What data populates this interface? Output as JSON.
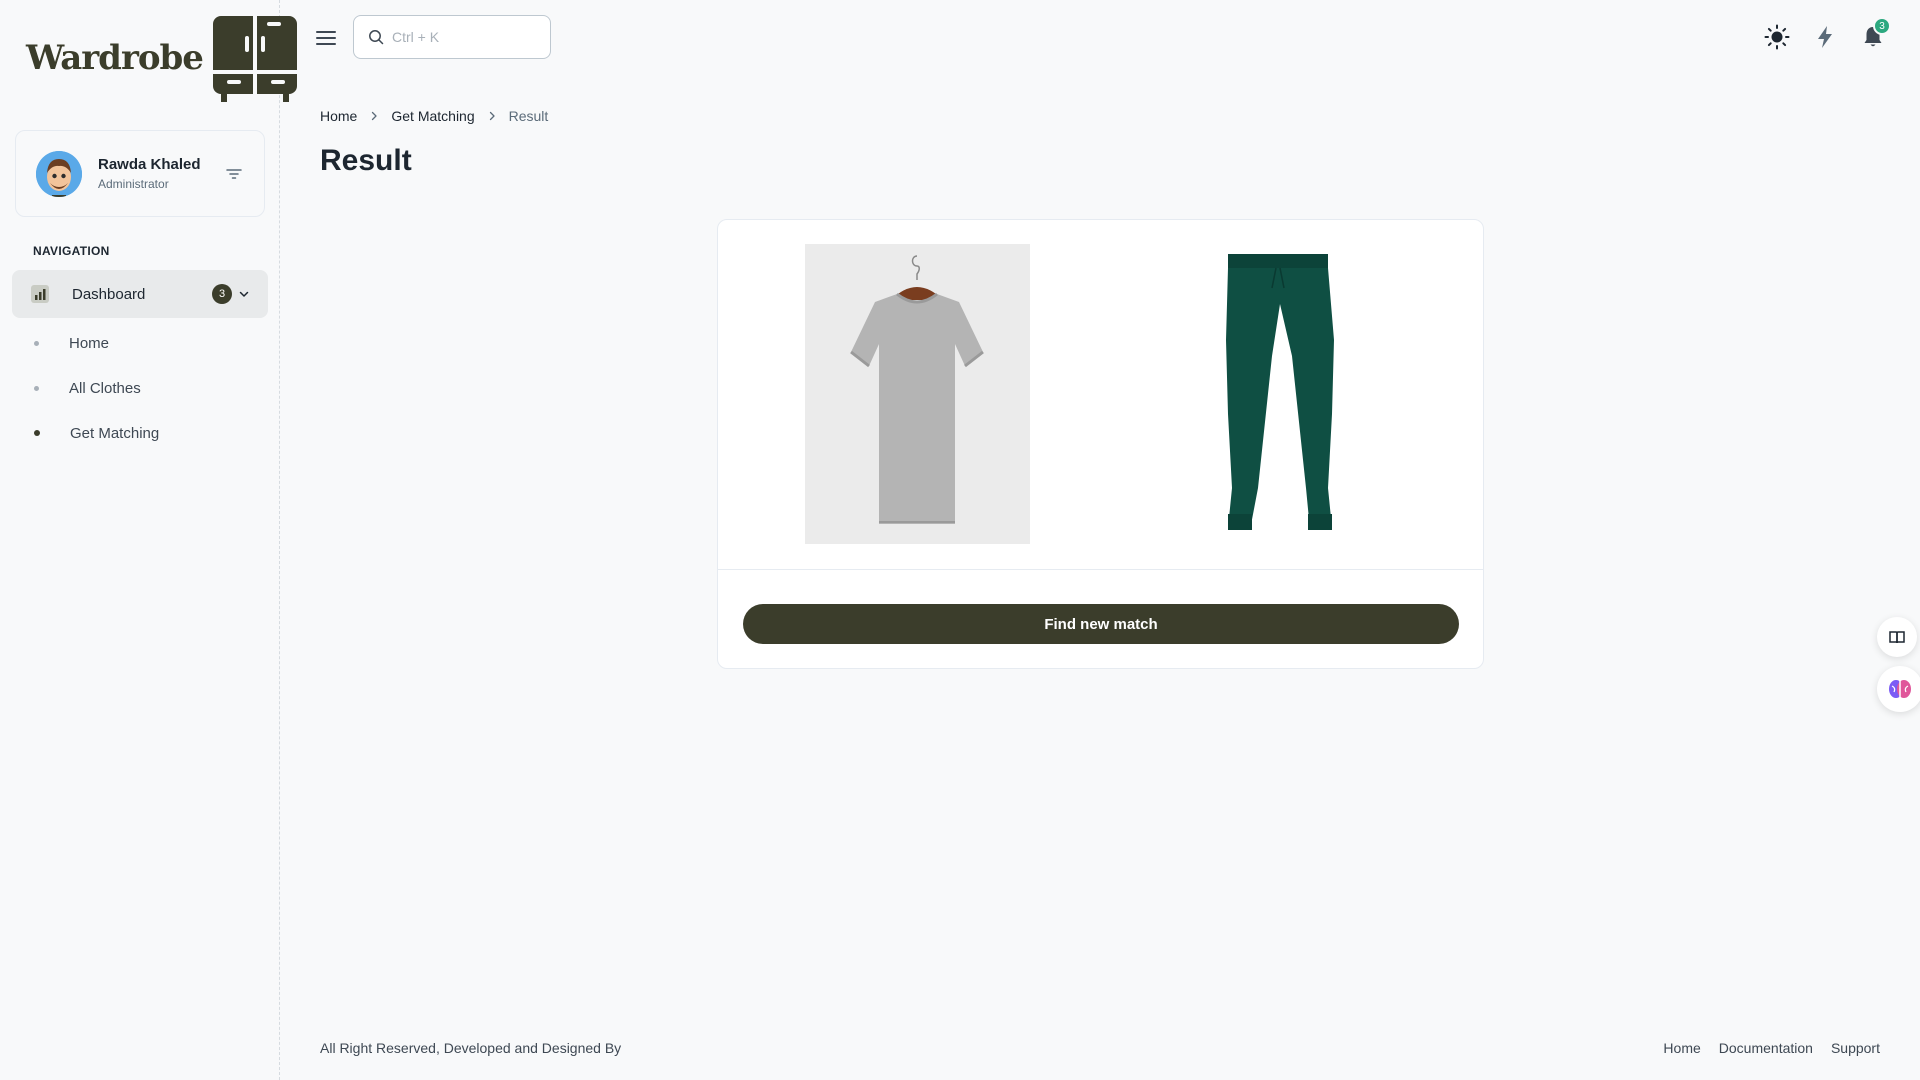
{
  "app": {
    "logo_text": "Wardrobe"
  },
  "user": {
    "name": "Rawda Khaled",
    "role": "Administrator"
  },
  "nav": {
    "caption": "NAVIGATION",
    "dashboard": {
      "label": "Dashboard",
      "badge": "3"
    },
    "items": [
      {
        "label": "Home",
        "active": false
      },
      {
        "label": "All Clothes",
        "active": false
      },
      {
        "label": "Get Matching",
        "active": true
      }
    ]
  },
  "header": {
    "search_placeholder": "Ctrl + K",
    "notification_count": "3"
  },
  "breadcrumb": [
    "Home",
    "Get Matching",
    "Result"
  ],
  "page_title": "Result",
  "result": {
    "items": [
      {
        "icon": "gray-tshirt-image"
      },
      {
        "icon": "green-sweatpants-image"
      }
    ],
    "button_label": "Find new match"
  },
  "footer": {
    "text": "All Right Reserved, Developed and Designed By",
    "links": [
      "Home",
      "Documentation",
      "Support"
    ]
  },
  "colors": {
    "brand": "#3b3d2b",
    "notification": "#2ca87f",
    "pants": "#0f4f43",
    "shirt": "#b4b4b4"
  }
}
